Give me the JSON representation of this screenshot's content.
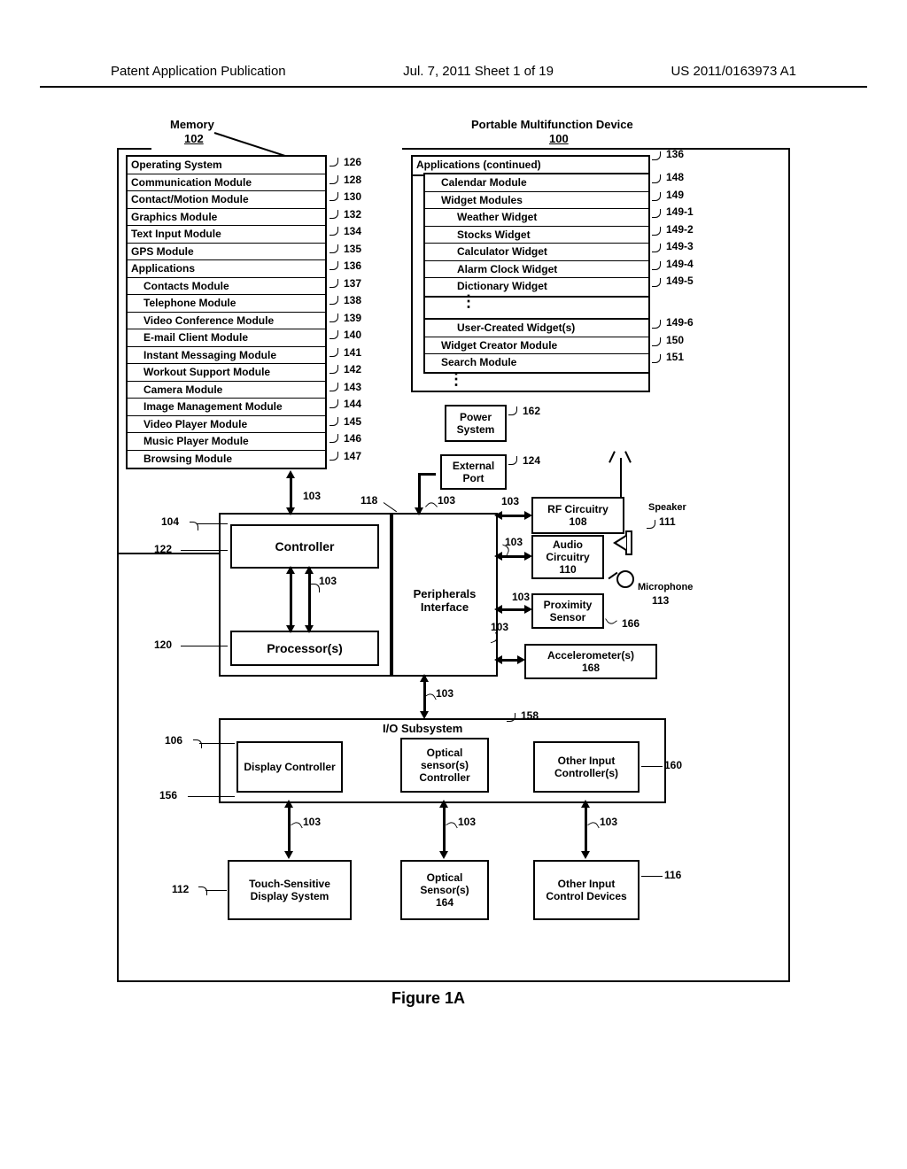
{
  "header": {
    "left": "Patent Application Publication",
    "mid": "Jul. 7, 2011   Sheet 1 of 19",
    "right": "US 2011/0163973 A1"
  },
  "titles": {
    "memory": "Memory",
    "memory_ref": "102",
    "device": "Portable Multifunction Device",
    "device_ref": "100"
  },
  "left_modules": [
    {
      "label": "Operating System",
      "ref": "126"
    },
    {
      "label": "Communication Module",
      "ref": "128"
    },
    {
      "label": "Contact/Motion Module",
      "ref": "130"
    },
    {
      "label": "Graphics Module",
      "ref": "132"
    },
    {
      "label": "Text Input Module",
      "ref": "134"
    },
    {
      "label": "GPS Module",
      "ref": "135"
    },
    {
      "label": "Applications",
      "ref": "136"
    },
    {
      "label": "Contacts Module",
      "ref": "137",
      "indent": 1
    },
    {
      "label": "Telephone Module",
      "ref": "138",
      "indent": 1
    },
    {
      "label": "Video Conference Module",
      "ref": "139",
      "indent": 1
    },
    {
      "label": "E-mail Client Module",
      "ref": "140",
      "indent": 1
    },
    {
      "label": "Instant Messaging Module",
      "ref": "141",
      "indent": 1
    },
    {
      "label": "Workout Support Module",
      "ref": "142",
      "indent": 1
    },
    {
      "label": "Camera Module",
      "ref": "143",
      "indent": 1
    },
    {
      "label": "Image Management Module",
      "ref": "144",
      "indent": 1
    },
    {
      "label": "Video Player Module",
      "ref": "145",
      "indent": 1
    },
    {
      "label": "Music Player Module",
      "ref": "146",
      "indent": 1
    },
    {
      "label": "Browsing Module",
      "ref": "147",
      "indent": 1
    }
  ],
  "right_modules_top": {
    "label": "Applications (continued)",
    "ref": "136"
  },
  "right_modules": [
    {
      "label": "Calendar Module",
      "ref": "148",
      "indent": 1
    },
    {
      "label": "Widget Modules",
      "ref": "149",
      "indent": 1
    },
    {
      "label": "Weather Widget",
      "ref": "149-1",
      "indent": 2
    },
    {
      "label": "Stocks Widget",
      "ref": "149-2",
      "indent": 2
    },
    {
      "label": "Calculator Widget",
      "ref": "149-3",
      "indent": 2
    },
    {
      "label": "Alarm Clock Widget",
      "ref": "149-4",
      "indent": 2
    },
    {
      "label": "Dictionary Widget",
      "ref": "149-5",
      "indent": 2
    }
  ],
  "right_modules2": [
    {
      "label": "User-Created Widget(s)",
      "ref": "149-6",
      "indent": 2
    },
    {
      "label": "Widget Creator Module",
      "ref": "150",
      "indent": 1
    },
    {
      "label": "Search Module",
      "ref": "151",
      "indent": 1
    }
  ],
  "blocks": {
    "power": {
      "label": "Power System",
      "ref": "162"
    },
    "external": {
      "label": "External Port",
      "ref": "124"
    },
    "controller": {
      "label": "Controller",
      "ref_left_104": "104",
      "ref_left_122": "122"
    },
    "processors": {
      "label": "Processor(s)",
      "ref": "120"
    },
    "peripherals": {
      "label": "Peripherals Interface",
      "ref": "118"
    },
    "rf": {
      "label": "RF Circuitry",
      "ref": "108"
    },
    "audio": {
      "label": "Audio Circuitry",
      "ref": "110"
    },
    "proximity": {
      "label": "Proximity Sensor",
      "ref": "166"
    },
    "accel": {
      "label": "Accelerometer(s)",
      "ref": "168"
    },
    "io_sub": {
      "label": "I/O Subsystem",
      "ref": "158"
    },
    "display_ctrl": {
      "label": "Display Controller",
      "ref_106": "106",
      "ref_156": "156"
    },
    "optical_ctrl": {
      "label": "Optical sensor(s) Controller"
    },
    "other_ctrl": {
      "label": "Other Input Controller(s)",
      "ref": "160"
    },
    "touch": {
      "label": "Touch-Sensitive Display System",
      "ref": "112"
    },
    "optical_sensors": {
      "label": "Optical Sensor(s)",
      "ref": "164"
    },
    "other_devices": {
      "label": "Other Input Control Devices",
      "ref": "116"
    },
    "speaker": {
      "label": "Speaker",
      "ref": "111"
    },
    "microphone": {
      "label": "Microphone",
      "ref": "113"
    }
  },
  "bus_ref": "103",
  "figure_caption": "Figure 1A"
}
